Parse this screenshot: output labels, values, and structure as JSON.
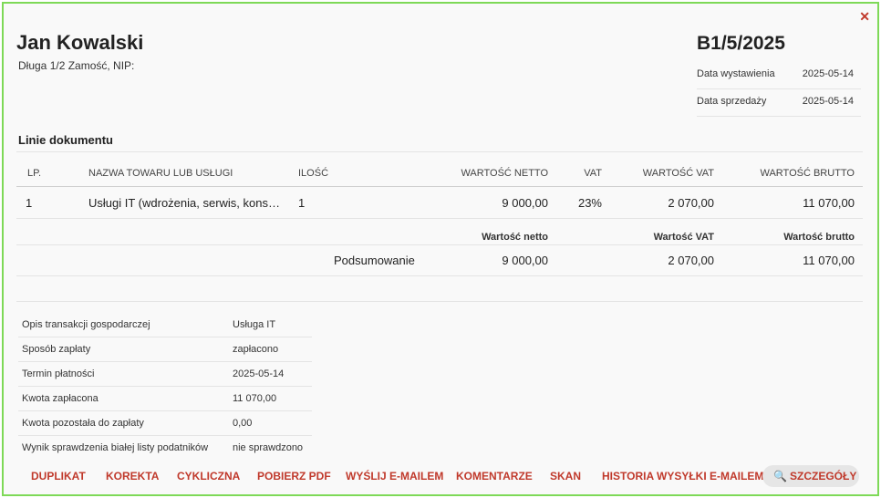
{
  "header": {
    "name": "Jan Kowalski",
    "address": "Długa 1/2 Zamość, NIP:",
    "doc_number": "B1/5/2025",
    "issue_date_label": "Data wystawienia",
    "issue_date": "2025-05-14",
    "sale_date_label": "Data sprzedaży",
    "sale_date": "2025-05-14",
    "close_icon": "close-icon"
  },
  "lines": {
    "title": "Linie dokumentu",
    "headers": {
      "lp": "LP.",
      "name": "NAZWA TOWARU LUB USŁUGI",
      "qty": "ILOŚĆ",
      "net": "WARTOŚĆ NETTO",
      "vat": "VAT",
      "vat_value": "WARTOŚĆ VAT",
      "gross": "WARTOŚĆ BRUTTO"
    },
    "rows": [
      {
        "lp": "1",
        "name": "Usługi IT (wdrożenia, serwis, kons…",
        "qty": "1",
        "net": "9 000,00",
        "vat": "23%",
        "vat_value": "2 070,00",
        "gross": "11 070,00"
      }
    ]
  },
  "summary": {
    "net_label": "Wartość netto",
    "vat_label": "Wartość VAT",
    "gross_label": "Wartość brutto",
    "row_label": "Podsumowanie",
    "net": "9 000,00",
    "vat": "2 070,00",
    "gross": "11 070,00"
  },
  "details": [
    {
      "key": "Opis transakcji gospodarczej",
      "value": "Usługa IT"
    },
    {
      "key": "Sposób zapłaty",
      "value": "zapłacono"
    },
    {
      "key": "Termin płatności",
      "value": "2025-05-14"
    },
    {
      "key": "Kwota zapłacona",
      "value": "11 070,00"
    },
    {
      "key": "Kwota pozostała do zapłaty",
      "value": "0,00"
    },
    {
      "key": "Wynik sprawdzenia białej listy podatników",
      "value": "nie sprawdzono"
    }
  ],
  "actions": {
    "duplicate": "DUPLIKAT",
    "correction": "KOREKTA",
    "cyclic": "CYKLICZNA",
    "pdf": "POBIERZ PDF",
    "email": "WYŚLIJ E-MAILEM",
    "comments": "KOMENTARZE",
    "scan": "SKAN",
    "email_history": "HISTORIA WYSYŁKI E-MAILEM",
    "details": "SZCZEGÓŁY",
    "details_icon": "search-icon"
  },
  "colors": {
    "accent": "#c0392b",
    "frame_border": "#7ed957"
  }
}
